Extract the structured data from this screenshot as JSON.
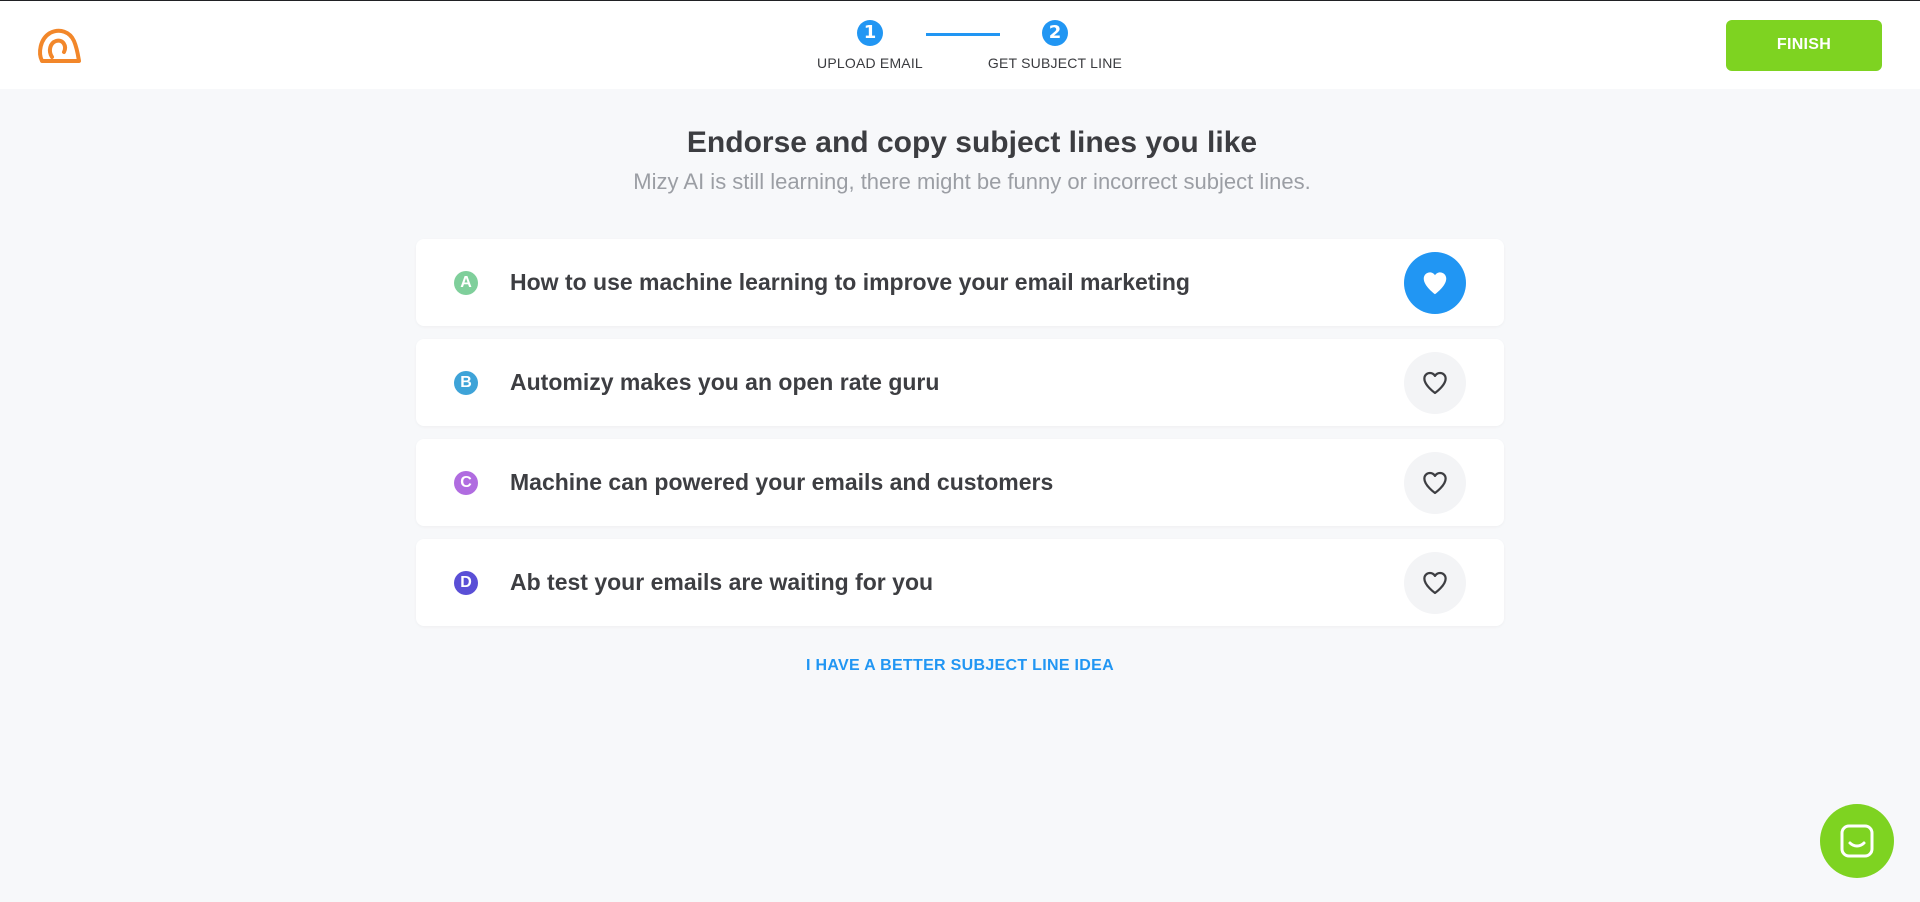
{
  "header": {
    "steps": [
      {
        "number": "1",
        "label": "UPLOAD EMAIL"
      },
      {
        "number": "2",
        "label": "GET SUBJECT LINE"
      }
    ],
    "finish_label": "FINISH"
  },
  "main": {
    "title": "Endorse and copy subject lines you like",
    "subtitle": "Mizy AI is still learning, there might be funny or incorrect subject lines.",
    "subject_lines": [
      {
        "letter": "A",
        "text": "How to use machine learning to improve your email marketing",
        "liked": true,
        "badge_color": "#7fcf9b"
      },
      {
        "letter": "B",
        "text": "Automizy makes you an open rate guru",
        "liked": false,
        "badge_color": "#3ea3d8"
      },
      {
        "letter": "C",
        "text": "Machine can powered your emails and customers",
        "liked": false,
        "badge_color": "#b06ce0"
      },
      {
        "letter": "D",
        "text": "Ab test your emails are waiting for you",
        "liked": false,
        "badge_color": "#5a4fd6"
      }
    ],
    "better_idea_label": "I HAVE A BETTER SUBJECT LINE IDEA"
  },
  "colors": {
    "accent_blue": "#2196f3",
    "accent_green": "#7ed321",
    "logo_orange": "#f2872a"
  },
  "icons": {
    "logo": "automizy-logo-icon",
    "like": "heart-icon",
    "chat": "chat-icon"
  }
}
